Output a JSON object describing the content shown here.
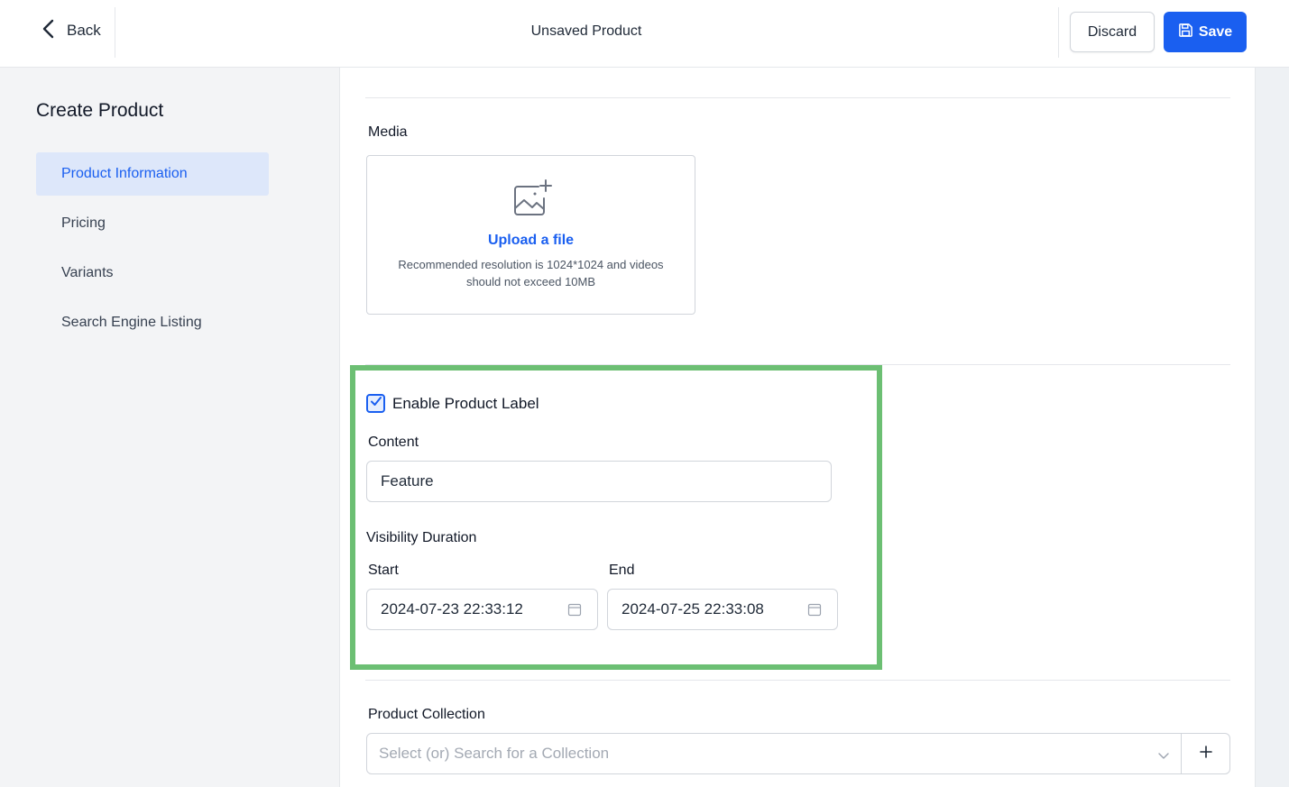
{
  "header": {
    "back_label": "Back",
    "title": "Unsaved Product",
    "discard_label": "Discard",
    "save_label": "Save"
  },
  "sidebar": {
    "title": "Create Product",
    "items": [
      {
        "label": "Product Information",
        "active": true
      },
      {
        "label": "Pricing",
        "active": false
      },
      {
        "label": "Variants",
        "active": false
      },
      {
        "label": "Search Engine Listing",
        "active": false
      }
    ]
  },
  "media": {
    "label": "Media",
    "upload_link": "Upload a file",
    "upload_hint": "Recommended resolution is 1024*1024 and videos should not exceed 10MB"
  },
  "product_label": {
    "enabled": true,
    "checkbox_label": "Enable Product Label",
    "content_label": "Content",
    "content_value": "Feature",
    "visibility_label": "Visibility Duration",
    "start_label": "Start",
    "start_value": "2024-07-23 22:33:12",
    "end_label": "End",
    "end_value": "2024-07-25 22:33:08"
  },
  "collection": {
    "label": "Product Collection",
    "placeholder": "Select (or) Search for a Collection"
  },
  "colors": {
    "accent": "#1a5ff0",
    "highlight": "#6cbf73",
    "active_nav_bg": "#dde7fa"
  },
  "icons": {
    "back": "chevron-left-icon",
    "save": "floppy-disk-icon",
    "upload": "image-plus-icon",
    "calendar": "calendar-icon",
    "dropdown": "chevron-down-icon",
    "add": "plus-icon"
  }
}
